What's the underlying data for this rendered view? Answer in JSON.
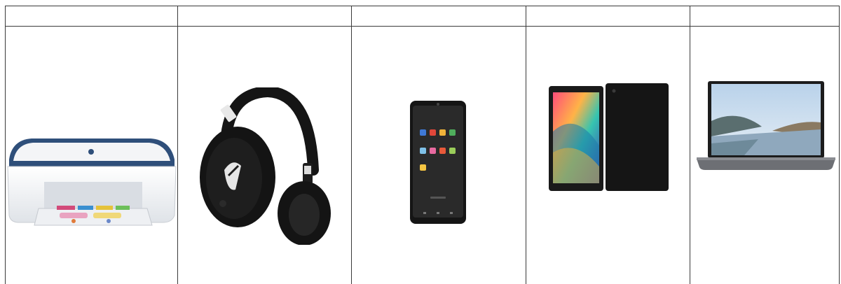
{
  "table": {
    "headers": [
      "",
      "",
      "",
      "",
      ""
    ],
    "products": [
      {
        "name": "printer",
        "icon": "printer-icon"
      },
      {
        "name": "headphones",
        "icon": "headphones-icon"
      },
      {
        "name": "smartphone",
        "icon": "smartphone-icon"
      },
      {
        "name": "tablet",
        "icon": "tablet-icon"
      },
      {
        "name": "laptop",
        "icon": "laptop-icon"
      }
    ]
  },
  "colors": {
    "grid_line": "#3a3a3a",
    "printer_accent": "#2f4f7a",
    "device_black": "#141414"
  }
}
